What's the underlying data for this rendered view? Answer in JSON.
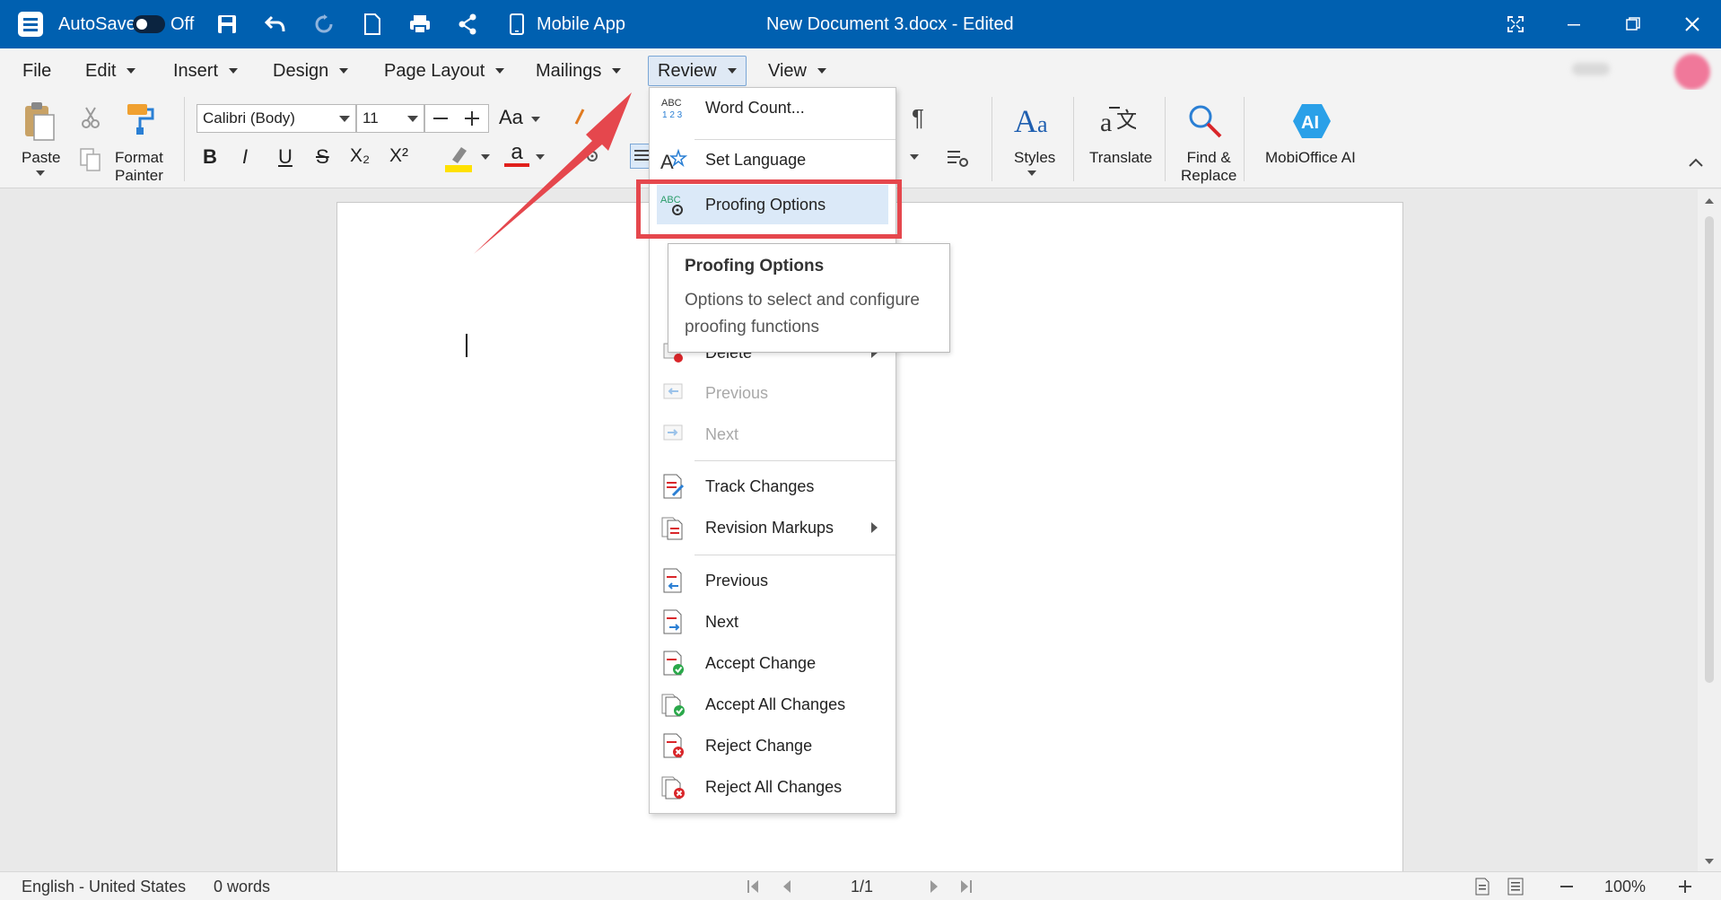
{
  "titlebar": {
    "autosave_label": "AutoSave",
    "autosave_state": "Off",
    "mobile_app_label": "Mobile App",
    "document_title": "New Document 3.docx - Edited",
    "bg_color": "#0060b0"
  },
  "menubar": {
    "items": [
      {
        "label": "File"
      },
      {
        "label": "Edit"
      },
      {
        "label": "Insert"
      },
      {
        "label": "Design"
      },
      {
        "label": "Page Layout"
      },
      {
        "label": "Mailings"
      },
      {
        "label": "Review"
      },
      {
        "label": "View"
      }
    ],
    "active": "Review"
  },
  "ribbon": {
    "paste_label": "Paste",
    "format_painter_label": "Format\nPainter",
    "font_name": "Calibri (Body)",
    "font_size": "11",
    "case_label": "Aa",
    "styles_label": "Styles",
    "translate_label": "Translate",
    "find_replace_label": "Find &\nReplace",
    "ai_label": "MobiOffice AI",
    "bold": "B",
    "italic": "I",
    "underline": "U",
    "strike": "S",
    "subscript": "X₂",
    "superscript": "X²",
    "font_color_letter": "a",
    "pilcrow": "¶",
    "highlight_color": "#ffe100",
    "font_color": "#e0201b"
  },
  "dropdown": {
    "items": [
      {
        "label": "Word Count...",
        "icon": "abc-123-icon",
        "state": "normal"
      },
      {
        "label": "Set Language",
        "icon": "language-icon",
        "state": "normal"
      },
      {
        "label": "Proofing Options",
        "icon": "proofing-gear-icon",
        "state": "highlighted"
      },
      {
        "label": "Delete",
        "icon": "delete-comment-icon",
        "state": "submenu"
      },
      {
        "label": "Previous",
        "icon": "previous-comment-icon",
        "state": "disabled"
      },
      {
        "label": "Next",
        "icon": "next-comment-icon",
        "state": "disabled"
      },
      {
        "label": "Track Changes",
        "icon": "track-changes-icon",
        "state": "normal"
      },
      {
        "label": "Revision Markups",
        "icon": "revision-markups-icon",
        "state": "submenu"
      },
      {
        "label": "Previous",
        "icon": "previous-change-icon",
        "state": "normal"
      },
      {
        "label": "Next",
        "icon": "next-change-icon",
        "state": "normal"
      },
      {
        "label": "Accept Change",
        "icon": "accept-change-icon",
        "state": "normal"
      },
      {
        "label": "Accept All Changes",
        "icon": "accept-all-changes-icon",
        "state": "normal"
      },
      {
        "label": "Reject Change",
        "icon": "reject-change-icon",
        "state": "normal"
      },
      {
        "label": "Reject All Changes",
        "icon": "reject-all-changes-icon",
        "state": "normal"
      }
    ]
  },
  "tooltip": {
    "title": "Proofing Options",
    "body": "Options to select and configure proofing functions"
  },
  "annotation": {
    "arrow_color": "#e5474d",
    "highlight_color": "#e5474d"
  },
  "statusbar": {
    "language": "English - United States",
    "word_count": "0 words",
    "page_indicator": "1/1",
    "zoom": "100%"
  }
}
